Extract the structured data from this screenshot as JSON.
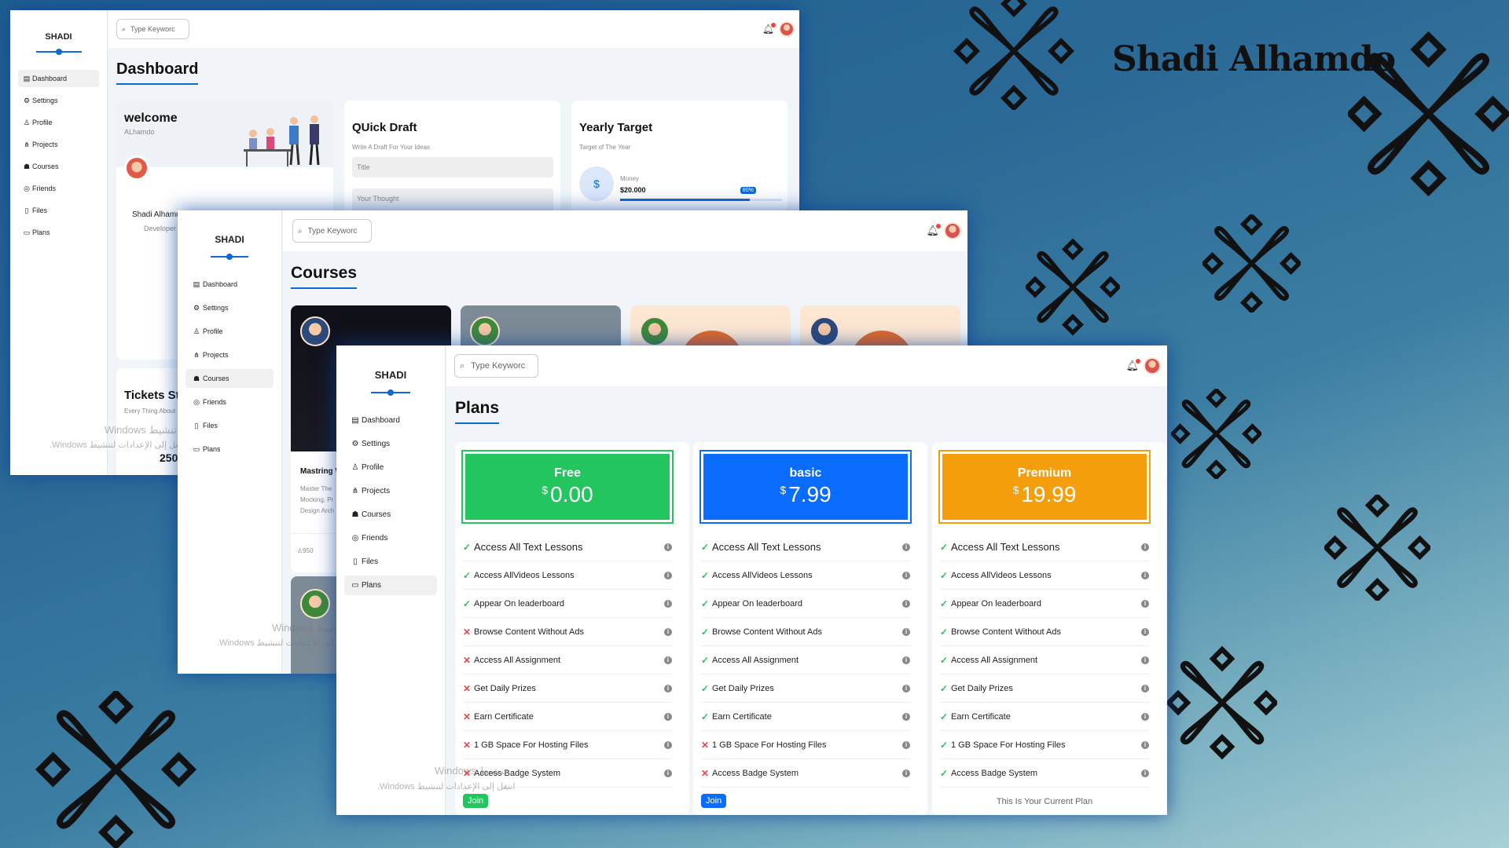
{
  "background": {
    "signature": "Shadi Alhamdo"
  },
  "brand": "SHADI",
  "nav": [
    "Dashboard",
    "Settings",
    "Profile",
    "Projects",
    "Courses",
    "Friends",
    "Files",
    "Plans"
  ],
  "search_placeholder": "Type Keyworc",
  "dashboard": {
    "title": "Dashboard",
    "welcome": {
      "title": "welcome",
      "subtitle": "ALhamdo",
      "name": "Shadi Alhamd",
      "role": "Developer"
    },
    "quick_draft": {
      "title": "QUick Draft",
      "subtitle": "Write A Draft For Your Ideas",
      "title_placeholder": "Title",
      "thought_placeholder": "Your Thought"
    },
    "yearly_target": {
      "title": "Yearly Target",
      "subtitle": "Target of The Year",
      "label": "Money",
      "value": "$20.000",
      "progress_label": "80%",
      "progress": 0.8
    },
    "tickets": {
      "title": "Tickets Sta",
      "subtitle": "Every Thing About",
      "value": "250"
    }
  },
  "courses": {
    "title": "Courses",
    "first_course": {
      "title": "Mastring W",
      "desc1": "Master The",
      "desc2": "Mocking, Pr",
      "desc3": "Design Arch",
      "students": "950"
    }
  },
  "plans": {
    "title": "Plans",
    "features": [
      "Access All Text Lessons",
      "Access AllVideos Lessons",
      "Appear On leaderboard",
      "Browse Content Without Ads",
      "Access All Assignment",
      "Get Daily Prizes",
      "Earn Certificate",
      "1 GB Space For Hosting Files",
      "Access Badge System"
    ],
    "items": [
      {
        "name": "Free",
        "currency": "$",
        "price": "0.00",
        "color": "#22c55e",
        "included": [
          true,
          true,
          true,
          false,
          false,
          false,
          false,
          false,
          false
        ],
        "action": "Join"
      },
      {
        "name": "basic",
        "currency": "$",
        "price": "7.99",
        "color": "#0a6cff",
        "included": [
          true,
          true,
          true,
          true,
          true,
          true,
          true,
          false,
          false
        ],
        "action": "Join"
      },
      {
        "name": "Premium",
        "currency": "$",
        "price": "19.99",
        "color": "#f59e0b",
        "included": [
          true,
          true,
          true,
          true,
          true,
          true,
          true,
          true,
          true
        ],
        "action": "This Is Your Current Plan"
      }
    ]
  },
  "watermark": {
    "line1": "Windows تنشيط",
    "line2": ".Windows انتقل إلى الإعدادات لتنشيط"
  }
}
